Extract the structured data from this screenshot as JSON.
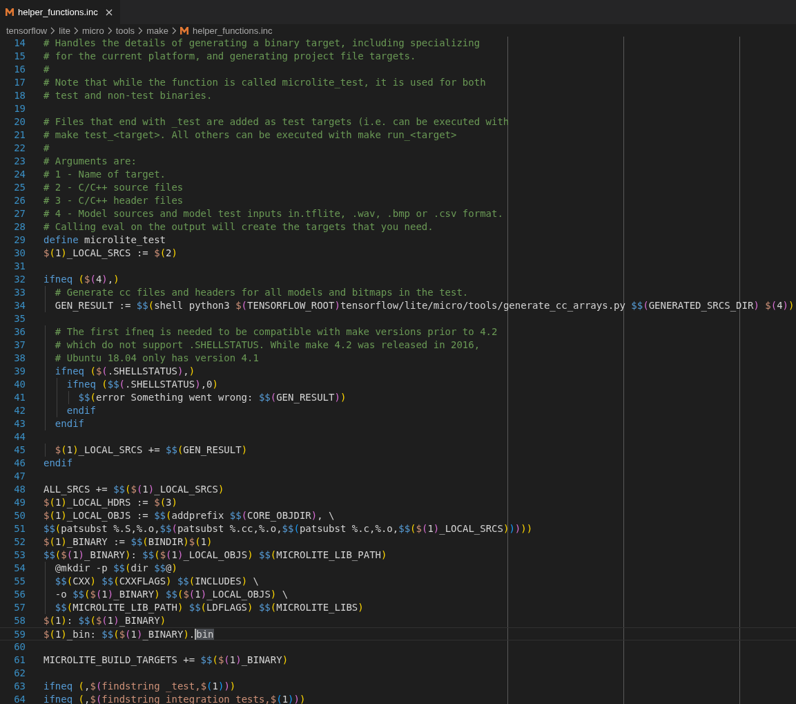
{
  "tabs": [
    {
      "label": "helper_functions.inc",
      "selected": true
    }
  ],
  "breadcrumbs": [
    {
      "label": "tensorflow"
    },
    {
      "label": "lite"
    },
    {
      "label": "micro"
    },
    {
      "label": "tools"
    },
    {
      "label": "make"
    },
    {
      "label": "helper_functions.inc",
      "kind": "file"
    }
  ],
  "lines": [
    {
      "number": "14",
      "tokens": [
        {
          "kind": "comment",
          "text": "# Handles the details of generating a binary target, including specializing"
        }
      ]
    },
    {
      "number": "15",
      "tokens": [
        {
          "kind": "comment",
          "text": "# for the current platform, and generating project file targets."
        }
      ]
    },
    {
      "number": "16",
      "tokens": [
        {
          "kind": "comment",
          "text": "#"
        }
      ]
    },
    {
      "number": "17",
      "tokens": [
        {
          "kind": "comment",
          "text": "# Note that while the function is called microlite_test, it is used for both"
        }
      ]
    },
    {
      "number": "18",
      "tokens": [
        {
          "kind": "comment",
          "text": "# test and non-test binaries."
        }
      ]
    },
    {
      "number": "19"
    },
    {
      "number": "20",
      "tokens": [
        {
          "kind": "comment",
          "text": "# Files that end with _test are added as test targets (i.e. can be executed with"
        }
      ]
    },
    {
      "number": "21",
      "tokens": [
        {
          "kind": "comment",
          "text": "# make test_<target>. All others can be executed with make run_<target>"
        }
      ]
    },
    {
      "number": "22",
      "tokens": [
        {
          "kind": "comment",
          "text": "#"
        }
      ]
    },
    {
      "number": "23",
      "tokens": [
        {
          "kind": "comment",
          "text": "# Arguments are:"
        }
      ]
    },
    {
      "number": "24",
      "tokens": [
        {
          "kind": "comment",
          "text": "# 1 - Name of target."
        }
      ]
    },
    {
      "number": "25",
      "tokens": [
        {
          "kind": "comment",
          "text": "# 2 - C/C++ source files"
        }
      ]
    },
    {
      "number": "26",
      "tokens": [
        {
          "kind": "comment",
          "text": "# 3 - C/C++ header files"
        }
      ]
    },
    {
      "number": "27",
      "tokens": [
        {
          "kind": "comment",
          "text": "# 4 - Model sources and model test inputs in.tflite, .wav, .bmp or .csv format."
        }
      ]
    },
    {
      "number": "28",
      "tokens": [
        {
          "kind": "comment",
          "text": "# Calling eval on the output will create the targets that you need."
        }
      ]
    },
    {
      "number": "29",
      "tokens": [
        {
          "kind": "keyword",
          "text": "define"
        },
        {
          "kind": "code",
          "text": " microlite_test"
        }
      ]
    },
    {
      "number": "30",
      "tokens": [
        {
          "kind": "code",
          "text": "$(1)_LOCAL_SRCS := $(2)"
        }
      ]
    },
    {
      "number": "31"
    },
    {
      "number": "32",
      "tokens": [
        {
          "kind": "keyword",
          "text": "ifneq"
        },
        {
          "kind": "code",
          "text": " ($(4),)"
        }
      ]
    },
    {
      "number": "33",
      "tokens": [
        {
          "kind": "comment",
          "text": "  # Generate cc files and headers for all models and bitmaps in the test."
        }
      ]
    },
    {
      "number": "34",
      "tokens": [
        {
          "kind": "code",
          "text": "  GEN_RESULT := $$(shell python3 $(TENSORFLOW_ROOT)tensorflow/lite/micro/tools/generate_cc_arrays.py $$(GENERATED_SRCS_DIR) $(4))"
        }
      ]
    },
    {
      "number": "35"
    },
    {
      "number": "36",
      "tokens": [
        {
          "kind": "comment",
          "text": "  # The first ifneq is needed to be compatible with make versions prior to 4.2"
        }
      ]
    },
    {
      "number": "37",
      "tokens": [
        {
          "kind": "comment",
          "text": "  # which do not support .SHELLSTATUS. While make 4.2 was released in 2016,"
        }
      ]
    },
    {
      "number": "38",
      "tokens": [
        {
          "kind": "comment",
          "text": "  # Ubuntu 18.04 only has version 4.1"
        }
      ]
    },
    {
      "number": "39",
      "tokens": [
        {
          "kind": "keyword",
          "text": "  ifneq"
        },
        {
          "kind": "code",
          "text": " ($(.SHELLSTATUS),)"
        }
      ]
    },
    {
      "number": "40",
      "tokens": [
        {
          "kind": "keyword",
          "text": "    ifneq"
        },
        {
          "kind": "code",
          "text": " ($$(.SHELLSTATUS),0)"
        }
      ]
    },
    {
      "number": "41",
      "tokens": [
        {
          "kind": "code",
          "text": "      $$(error Something went wrong: $$(GEN_RESULT))"
        }
      ]
    },
    {
      "number": "42",
      "tokens": [
        {
          "kind": "keyword",
          "text": "    endif"
        }
      ]
    },
    {
      "number": "43",
      "tokens": [
        {
          "kind": "keyword",
          "text": "  endif"
        }
      ]
    },
    {
      "number": "44"
    },
    {
      "number": "45",
      "tokens": [
        {
          "kind": "code",
          "text": "  $(1)_LOCAL_SRCS += $$(GEN_RESULT)"
        }
      ]
    },
    {
      "number": "46",
      "tokens": [
        {
          "kind": "keyword",
          "text": "endif"
        }
      ]
    },
    {
      "number": "47"
    },
    {
      "number": "48",
      "tokens": [
        {
          "kind": "code",
          "text": "ALL_SRCS += $$($(1)_LOCAL_SRCS)"
        }
      ]
    },
    {
      "number": "49",
      "tokens": [
        {
          "kind": "code",
          "text": "$(1)_LOCAL_HDRS := $(3)"
        }
      ]
    },
    {
      "number": "50",
      "tokens": [
        {
          "kind": "code",
          "text": "$(1)_LOCAL_OBJS := $$(addprefix $$(CORE_OBJDIR), \\"
        }
      ]
    },
    {
      "number": "51",
      "tokens": [
        {
          "kind": "code",
          "text": "$$(patsubst %.S,%.o,$$(patsubst %.cc,%.o,$$(patsubst %.c,%.o,$$($(1)_LOCAL_SRCS)))))"
        }
      ]
    },
    {
      "number": "52",
      "tokens": [
        {
          "kind": "code",
          "text": "$(1)_BINARY := $$(BINDIR)$(1)"
        }
      ]
    },
    {
      "number": "53",
      "tokens": [
        {
          "kind": "code",
          "text": "$$($(1)_BINARY): $$($(1)_LOCAL_OBJS) $$(MICROLITE_LIB_PATH)"
        }
      ]
    },
    {
      "number": "54",
      "tokens": [
        {
          "kind": "code",
          "text": "  @mkdir -p $$(dir $$@)"
        }
      ]
    },
    {
      "number": "55",
      "tokens": [
        {
          "kind": "code",
          "text": "  $$(CXX) $$(CXXFLAGS) $$(INCLUDES) \\"
        }
      ]
    },
    {
      "number": "56",
      "tokens": [
        {
          "kind": "code",
          "text": "  -o $$($(1)_BINARY) $$($(1)_LOCAL_OBJS) \\"
        }
      ]
    },
    {
      "number": "57",
      "tokens": [
        {
          "kind": "code",
          "text": "  $$(MICROLITE_LIB_PATH) $$(LDFLAGS) $$(MICROLITE_LIBS)"
        }
      ]
    },
    {
      "number": "58",
      "tokens": [
        {
          "kind": "code",
          "text": "$(1): $$($(1)_BINARY)"
        }
      ]
    },
    {
      "number": "59",
      "current": true,
      "tokens": [
        {
          "kind": "code",
          "text": "$(1)_bin: $$($(1)_BINARY)."
        },
        {
          "kind": "selection",
          "text": "bin"
        }
      ]
    },
    {
      "number": "60"
    },
    {
      "number": "61",
      "tokens": [
        {
          "kind": "code",
          "text": "MICROLITE_BUILD_TARGETS += $$($(1)_BINARY)"
        }
      ]
    },
    {
      "number": "62"
    },
    {
      "number": "63",
      "tokens": [
        {
          "kind": "keyword",
          "text": "ifneq"
        },
        {
          "kind": "code",
          "text": " (,$("
        },
        {
          "kind": "string",
          "text": "findstring _test,"
        },
        {
          "kind": "code",
          "text": "$(1)))"
        }
      ]
    },
    {
      "number": "64",
      "tokens": [
        {
          "kind": "keyword",
          "text": "ifneq"
        },
        {
          "kind": "code",
          "text": " (,$("
        },
        {
          "kind": "string",
          "text": "findstring integration_tests,"
        },
        {
          "kind": "code",
          "text": "$(1)))"
        }
      ]
    }
  ]
}
